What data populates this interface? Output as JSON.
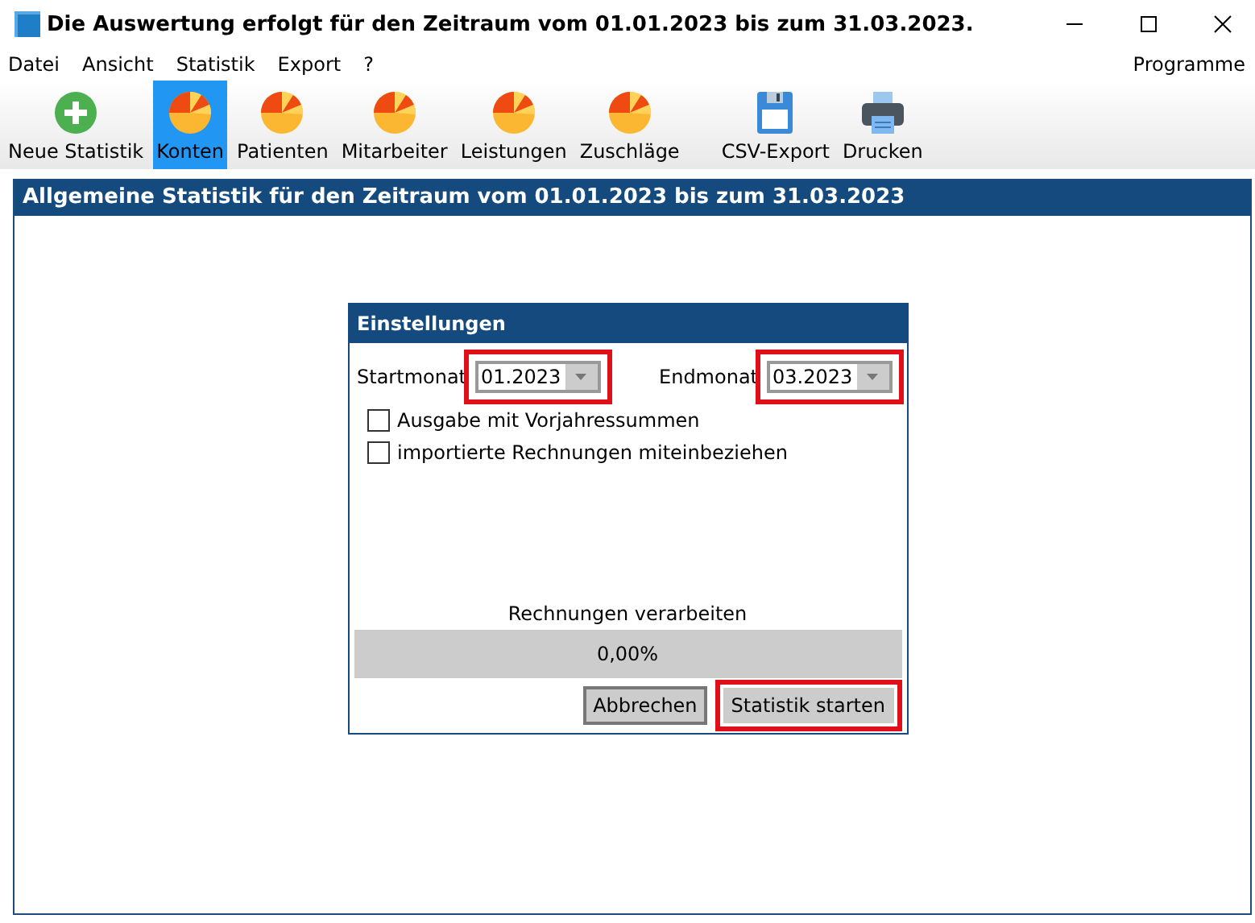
{
  "window": {
    "title": "Die Auswertung erfolgt für den Zeitraum vom 01.01.2023 bis zum 31.03.2023."
  },
  "menu": [
    {
      "label": "Datei"
    },
    {
      "label": "Ansicht"
    },
    {
      "label": "Statistik"
    },
    {
      "label": "Export"
    },
    {
      "label": "?"
    }
  ],
  "menu_right": "Programme",
  "toolbar": [
    {
      "label": "Neue Statistik",
      "kind": "add",
      "selected": false
    },
    {
      "label": "Konten",
      "kind": "pie",
      "selected": true
    },
    {
      "label": "Patienten",
      "kind": "pie",
      "selected": false
    },
    {
      "label": "Mitarbeiter",
      "kind": "pie",
      "selected": false
    },
    {
      "label": "Leistungen",
      "kind": "pie",
      "selected": false
    },
    {
      "label": "Zuschläge",
      "kind": "pie",
      "selected": false
    },
    {
      "label": "CSV-Export",
      "kind": "csv",
      "selected": false
    },
    {
      "label": "Drucken",
      "kind": "print",
      "selected": false
    }
  ],
  "panel": {
    "title": "Allgemeine Statistik für den Zeitraum vom 01.01.2023 bis zum 31.03.2023"
  },
  "dialog": {
    "title": "Einstellungen",
    "fields": [
      {
        "label": "Startmonat",
        "value": "01.2023",
        "highlighted": true
      },
      {
        "label": "Endmonat",
        "value": "03.2023",
        "highlighted": true
      }
    ],
    "checkboxes": [
      {
        "label": "Ausgabe mit Vorjahressummen",
        "checked": false
      },
      {
        "label": "importierte Rechnungen miteinbeziehen",
        "checked": false
      }
    ],
    "progress": {
      "label": "Rechnungen verarbeiten",
      "reading": "0,00%",
      "level": 0
    },
    "buttons": [
      {
        "label": "Abbrechen",
        "focused": true,
        "highlighted": false
      },
      {
        "label": "Statistik starten",
        "focused": false,
        "highlighted": true
      }
    ]
  }
}
